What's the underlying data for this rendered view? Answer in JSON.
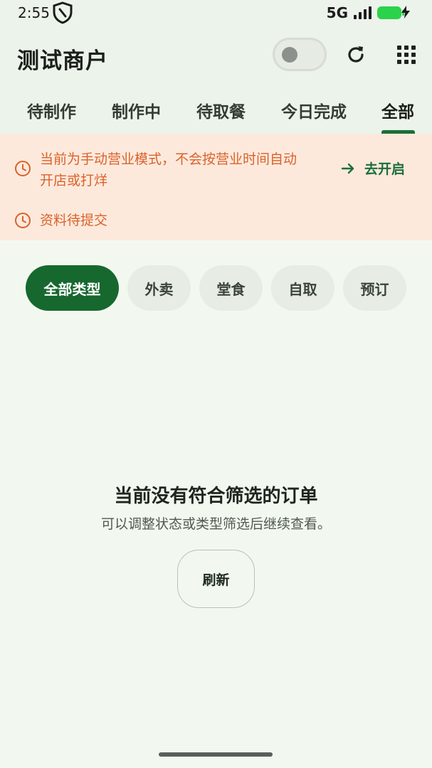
{
  "status_bar": {
    "time": "2:55",
    "network": "5G",
    "icons": [
      "vpn-shield-icon",
      "signal-icon",
      "battery-icon",
      "charging-bolt-icon"
    ],
    "battery_color": "#2bd34b"
  },
  "header": {
    "title": "测试商户",
    "business_toggle": {
      "state": "off"
    },
    "refresh_icon": "refresh-icon",
    "menu_icon": "grid-menu-icon"
  },
  "tabs": {
    "items": [
      {
        "label": "待制作"
      },
      {
        "label": "制作中"
      },
      {
        "label": "待取餐"
      },
      {
        "label": "今日完成"
      },
      {
        "label": "全部"
      }
    ],
    "active": "全部"
  },
  "notice": {
    "manual_mode_line1": "当前为手动营业模式，不会按营业时间自动",
    "manual_mode_line2": "开店或打烊",
    "action_label": "去开启",
    "pending_info": "资料待提交",
    "icon": "clock-icon",
    "text_color": "#d9622a",
    "action_color": "#1b6e3a"
  },
  "filters": {
    "items": [
      {
        "label": "全部类型"
      },
      {
        "label": "外卖"
      },
      {
        "label": "堂食"
      },
      {
        "label": "自取"
      },
      {
        "label": "预订"
      }
    ],
    "active": "全部类型",
    "active_color": "#16682f"
  },
  "empty_state": {
    "title": "当前没有符合筛选的订单",
    "subtitle": "可以调整状态或类型筛选后继续查看。",
    "refresh_button": "刷新"
  }
}
